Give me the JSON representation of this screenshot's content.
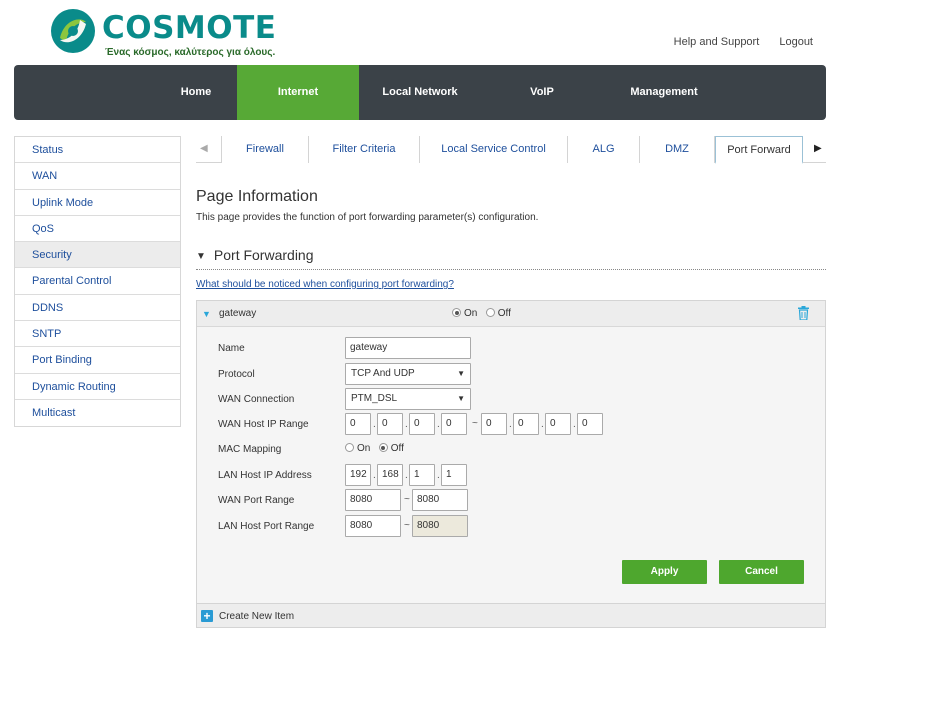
{
  "brand": {
    "name": "COSMOTE",
    "tagline": "Ένας κόσμος, καλύτερος για όλους."
  },
  "top_links": {
    "help": "Help and Support",
    "logout": "Logout"
  },
  "main_nav": {
    "home": "Home",
    "internet": "Internet",
    "local_network": "Local Network",
    "voip": "VoIP",
    "management": "Management"
  },
  "sidebar": {
    "items": [
      "Status",
      "WAN",
      "Uplink Mode",
      "QoS",
      "Security",
      "Parental Control",
      "DDNS",
      "SNTP",
      "Port Binding",
      "Dynamic Routing",
      "Multicast"
    ],
    "active": "Security"
  },
  "sub_tabs": {
    "firewall": "Firewall",
    "filter_criteria": "Filter Criteria",
    "local_service_control": "Local Service Control",
    "alg": "ALG",
    "dmz": "DMZ",
    "port_forward": "Port Forward"
  },
  "page_info": {
    "title": "Page Information",
    "description": "This page provides the function of port forwarding parameter(s) configuration."
  },
  "section": {
    "title": "Port Forwarding",
    "notice_link": "What should be noticed when configuring port forwarding?"
  },
  "entry": {
    "name": "gateway",
    "on_label": "On",
    "off_label": "Off",
    "state": "On"
  },
  "form": {
    "name_label": "Name",
    "name_value": "gateway",
    "protocol_label": "Protocol",
    "protocol_value": "TCP And UDP",
    "wan_conn_label": "WAN Connection",
    "wan_conn_value": "PTM_DSL",
    "wan_ip_label": "WAN Host IP Range",
    "wan_ip_start": [
      "0",
      "0",
      "0",
      "0"
    ],
    "wan_ip_end": [
      "0",
      "0",
      "0",
      "0"
    ],
    "mac_label": "MAC Mapping",
    "mac_on": "On",
    "mac_off": "Off",
    "mac_state": "Off",
    "lan_ip_label": "LAN Host IP Address",
    "lan_ip": [
      "192",
      "168",
      "1",
      "1"
    ],
    "wan_port_label": "WAN Port Range",
    "wan_port_start": "8080",
    "wan_port_end": "8080",
    "lan_port_label": "LAN Host Port Range",
    "lan_port_start": "8080",
    "lan_port_end": "8080",
    "range_sep": "~",
    "dot_sep": "."
  },
  "buttons": {
    "apply": "Apply",
    "cancel": "Cancel"
  },
  "create_item": "Create New Item",
  "colors": {
    "brand_teal": "#0a8b8a",
    "nav_dark": "#3b4248",
    "accent_green": "#57a936",
    "link_blue": "#1e4f9c"
  }
}
